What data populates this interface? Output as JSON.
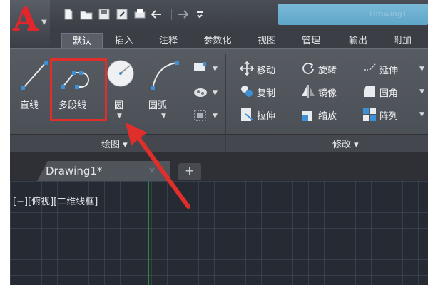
{
  "app": {
    "logo_letter": "A",
    "window_title": "Drawing1"
  },
  "colors": {
    "accent_red": "#e3262c",
    "highlight_red": "#e02f2a",
    "title_blue": "#6aaed0",
    "canvas_bg": "#262a33"
  },
  "ribbon_tabs": [
    "默认",
    "插入",
    "注释",
    "参数化",
    "视图",
    "管理",
    "输出",
    "附加"
  ],
  "draw_panel": {
    "title": "绘图 ▾",
    "tools": {
      "line": "直线",
      "polyline": "多段线",
      "circle": "圆",
      "arc": "圆弧"
    }
  },
  "modify_panel": {
    "title": "修改 ▾",
    "tools": {
      "move": "移动",
      "rotate": "旋转",
      "trim": "延伸",
      "copy": "复制",
      "mirror": "镜像",
      "fillet": "圆角",
      "stretch": "拉伸",
      "scale": "缩放",
      "array": "阵列"
    }
  },
  "document": {
    "tab_label": "Drawing1*",
    "close_glyph": "×",
    "add_glyph": "+"
  },
  "viewport": {
    "label": "[−][俯视][二维线框]"
  },
  "icons": [
    "new-icon",
    "open-icon",
    "save-icon",
    "saveas-icon",
    "print-icon",
    "undo-icon",
    "redo-icon",
    "qat-menu-icon"
  ]
}
